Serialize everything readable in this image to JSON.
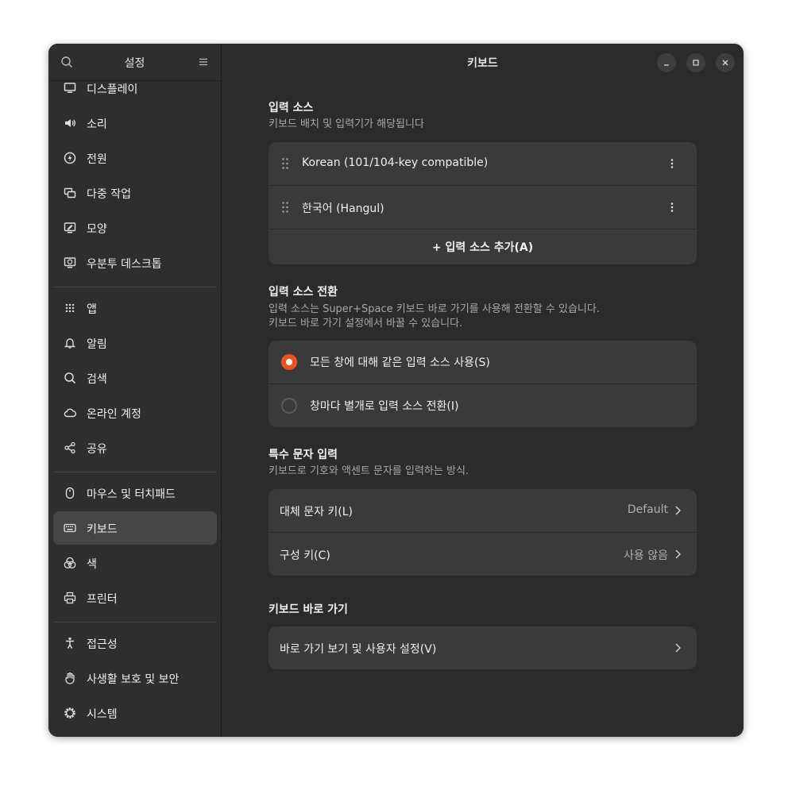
{
  "sidebar": {
    "title": "설정",
    "search_icon": "search-icon",
    "menu_icon": "hamburger-menu-icon",
    "items": [
      {
        "label": "디스플레이",
        "icon": "display-icon"
      },
      {
        "label": "소리",
        "icon": "speaker-icon"
      },
      {
        "label": "전원",
        "icon": "power-icon"
      },
      {
        "label": "다중 작업",
        "icon": "multitasking-icon"
      },
      {
        "label": "모양",
        "icon": "appearance-icon"
      },
      {
        "label": "우분투 데스크톱",
        "icon": "ubuntu-desktop-icon"
      },
      {
        "label": "앱",
        "icon": "apps-grid-icon"
      },
      {
        "label": "알림",
        "icon": "bell-icon"
      },
      {
        "label": "검색",
        "icon": "search-icon"
      },
      {
        "label": "온라인 계정",
        "icon": "cloud-icon"
      },
      {
        "label": "공유",
        "icon": "share-icon"
      },
      {
        "label": "마우스 및 터치패드",
        "icon": "mouse-icon"
      },
      {
        "label": "키보드",
        "icon": "keyboard-icon",
        "active": true
      },
      {
        "label": "색",
        "icon": "color-icon"
      },
      {
        "label": "프린터",
        "icon": "printer-icon"
      },
      {
        "label": "접근성",
        "icon": "accessibility-icon"
      },
      {
        "label": "사생활 보호 및 보안",
        "icon": "hand-icon"
      },
      {
        "label": "시스템",
        "icon": "gear-icon"
      }
    ]
  },
  "header": {
    "title": "키보드",
    "minimize_icon": "minimize-icon",
    "maximize_icon": "maximize-icon",
    "close_icon": "close-icon"
  },
  "input_sources": {
    "title": "입력 소스",
    "subtitle": "키보드 배치 및 입력기가 해당됩니다",
    "sources": [
      {
        "label": "Korean (101/104-key compatible)"
      },
      {
        "label": "한국어 (Hangul)"
      }
    ],
    "add_label": "+  입력 소스 추가(A)"
  },
  "source_switching": {
    "title": "입력 소스 전환",
    "subtitle_line1": "입력 소스는 Super+Space 키보드 바로 가기를 사용해 전환할 수 있습니다.",
    "subtitle_line2": "키보드 바로 가기 설정에서 바꿀 수 있습니다.",
    "options": [
      {
        "label": "모든 창에 대해 같은 입력 소스 사용(S)",
        "selected": true
      },
      {
        "label": "창마다 별개로 입력 소스 전환(I)",
        "selected": false
      }
    ]
  },
  "special_chars": {
    "title": "특수 문자 입력",
    "subtitle": "키보드로 기호와 액센트 문자를 입력하는 방식.",
    "rows": [
      {
        "label": "대체 문자 키(L)",
        "value": "Default"
      },
      {
        "label": "구성 키(C)",
        "value": "사용 않음"
      }
    ]
  },
  "shortcuts": {
    "title": "키보드 바로 가기",
    "row_label": "바로 가기 보기 및 사용자 설정(V)"
  },
  "colors": {
    "accent": "#e95420",
    "window_bg": "#2b2b2b",
    "sidebar_bg": "#2e2e2e",
    "card_bg": "#3a3a3a",
    "active_item_bg": "#464646"
  }
}
